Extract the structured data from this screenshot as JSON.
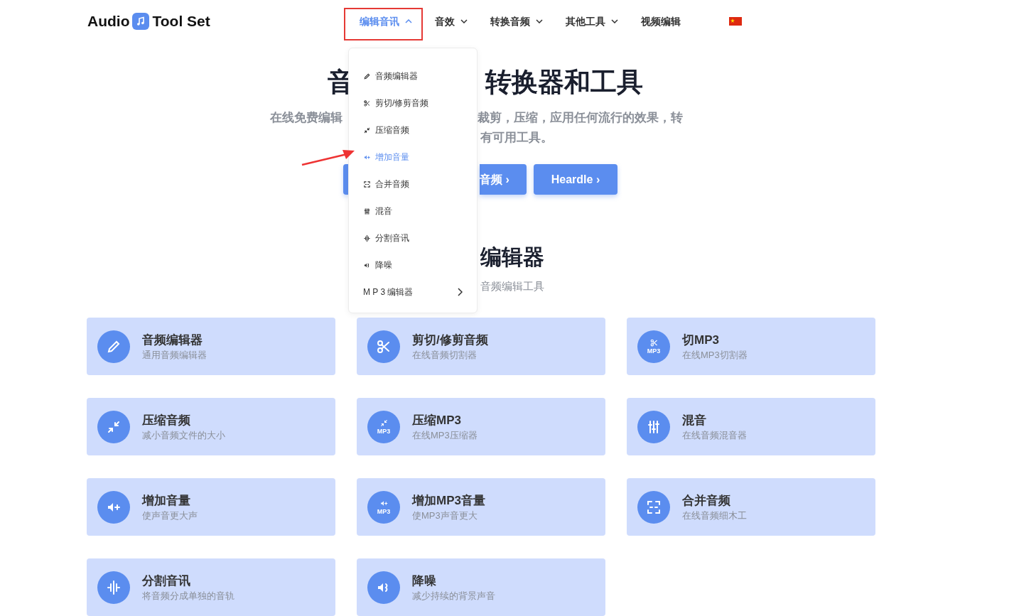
{
  "logo": {
    "left": "Audio",
    "right": "Tool Set"
  },
  "nav": [
    {
      "label": "编辑音讯",
      "selected": true,
      "kind": "dropdown",
      "expanded": true
    },
    {
      "label": "音效",
      "selected": false,
      "kind": "dropdown",
      "expanded": false
    },
    {
      "label": "转换音频",
      "selected": false,
      "kind": "dropdown",
      "expanded": false
    },
    {
      "label": "其他工具",
      "selected": false,
      "kind": "dropdown",
      "expanded": false
    },
    {
      "label": "视频编辑",
      "selected": false,
      "kind": "link"
    }
  ],
  "dropdown_menu": [
    {
      "label": "音频编辑器",
      "kind": "pencil",
      "selected": false,
      "submenu": false
    },
    {
      "label": "剪切/修剪音频",
      "kind": "scissors",
      "selected": false,
      "submenu": false
    },
    {
      "label": "压缩音频",
      "kind": "compress",
      "selected": false,
      "submenu": false
    },
    {
      "label": "增加音量",
      "kind": "volume-plus",
      "selected": true,
      "submenu": false
    },
    {
      "label": "合并音频",
      "kind": "merge",
      "selected": false,
      "submenu": false
    },
    {
      "label": "混音",
      "kind": "sliders",
      "selected": false,
      "submenu": false
    },
    {
      "label": "分割音讯",
      "kind": "split",
      "selected": false,
      "submenu": false
    },
    {
      "label": "降噪",
      "kind": "noise",
      "selected": false,
      "submenu": false
    },
    {
      "label": "M P 3 编辑器",
      "kind": "none",
      "selected": false,
      "submenu": true
    }
  ],
  "hero": {
    "title_parts": [
      "音",
      "转换器和工具"
    ],
    "subtitle_parts": [
      "在线免费编辑",
      "裁剪，压缩，应用任何流行的效果，转",
      "有可用工具。"
    ],
    "buttons": [
      "音频 ›",
      "Heardle ›"
    ]
  },
  "section": {
    "title": "编辑器",
    "subtitle": "音频编辑工具"
  },
  "cards": [
    {
      "title": "音频编辑器",
      "subtitle": "通用音频编辑器",
      "kind": "pencil"
    },
    {
      "title": "剪切/修剪音频",
      "subtitle": "在线音频切割器",
      "kind": "scissors"
    },
    {
      "title": "切MP3",
      "subtitle": "在线MP3切割器",
      "kind": "scissors-mp3",
      "icon_text": "MP3"
    },
    {
      "title": "压缩音频",
      "subtitle": "减小音频文件的大小",
      "kind": "compress"
    },
    {
      "title": "压缩MP3",
      "subtitle": "在线MP3压缩器",
      "kind": "compress-mp3",
      "icon_text": "MP3"
    },
    {
      "title": "混音",
      "subtitle": "在线音频混音器",
      "kind": "sliders"
    },
    {
      "title": "增加音量",
      "subtitle": "使声音更大声",
      "kind": "volume-plus"
    },
    {
      "title": "增加MP3音量",
      "subtitle": "使MP3声音更大",
      "kind": "volume-plus-mp3",
      "icon_text": "MP3"
    },
    {
      "title": "合并音频",
      "subtitle": "在线音频细木工",
      "kind": "merge"
    },
    {
      "title": "分割音讯",
      "subtitle": "将音频分成单独的音轨",
      "kind": "split"
    },
    {
      "title": "降噪",
      "subtitle": "减少持续的背景声音",
      "kind": "noise"
    }
  ]
}
